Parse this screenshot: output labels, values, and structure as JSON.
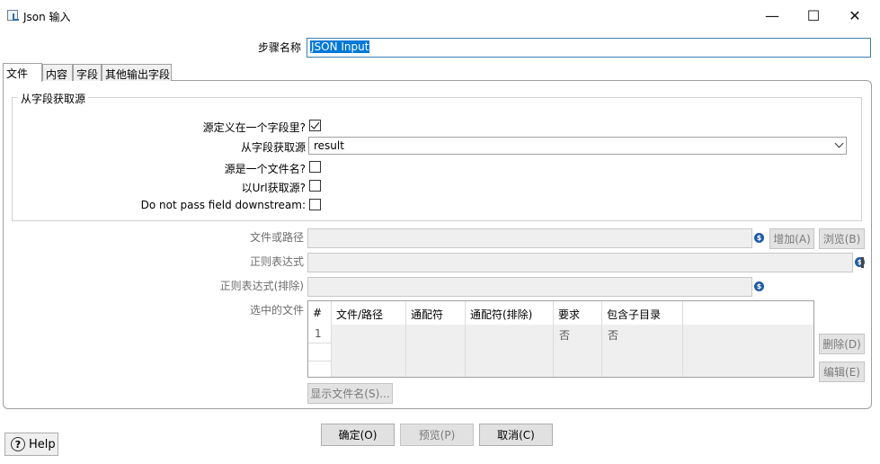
{
  "window": {
    "title": "Json 输入",
    "minimize": "—",
    "maximize": "☐",
    "close": "✕"
  },
  "step_name": {
    "label": "步骤名称",
    "value": "JSON Input"
  },
  "tabs": [
    {
      "label": "文件",
      "active": true
    },
    {
      "label": "内容",
      "active": false
    },
    {
      "label": "字段",
      "active": false
    },
    {
      "label": "其他输出字段",
      "active": false
    }
  ],
  "group": {
    "title": "从字段获取源",
    "source_in_field_label": "源定义在一个字段里?",
    "source_in_field_checked": true,
    "get_source_from_field_label": "从字段获取源",
    "get_source_from_field_value": "result",
    "source_is_filename_label": "源是一个文件名?",
    "source_is_filename_checked": false,
    "read_source_as_url_label": "以Url获取源?",
    "read_source_as_url_checked": false,
    "do_not_pass_label": "Do not pass field downstream:",
    "do_not_pass_checked": false
  },
  "files": {
    "file_or_dir_label": "文件或路径",
    "regex_label": "正则表达式",
    "regex_exclude_label": "正则表达式(排除)",
    "selected_files_label": "选中的文件",
    "add_button": "增加(A)",
    "browse_button": "浏览(B)",
    "delete_button": "删除(D)",
    "edit_button": "编辑(E)",
    "show_filenames_button": "显示文件名(S)...",
    "var_icon": "$",
    "table": {
      "columns": [
        "#",
        "文件/路径",
        "通配符",
        "通配符(排除)",
        "要求",
        "包含子目录"
      ],
      "rows": [
        {
          "num": "1",
          "path": "",
          "wildcard": "",
          "wildcard_exclude": "",
          "required": "否",
          "include_subfolders": "否"
        }
      ]
    }
  },
  "buttons": {
    "ok": "确定(O)",
    "preview": "预览(P)",
    "cancel": "取消(C)",
    "help": "Help",
    "help_icon": "?"
  }
}
